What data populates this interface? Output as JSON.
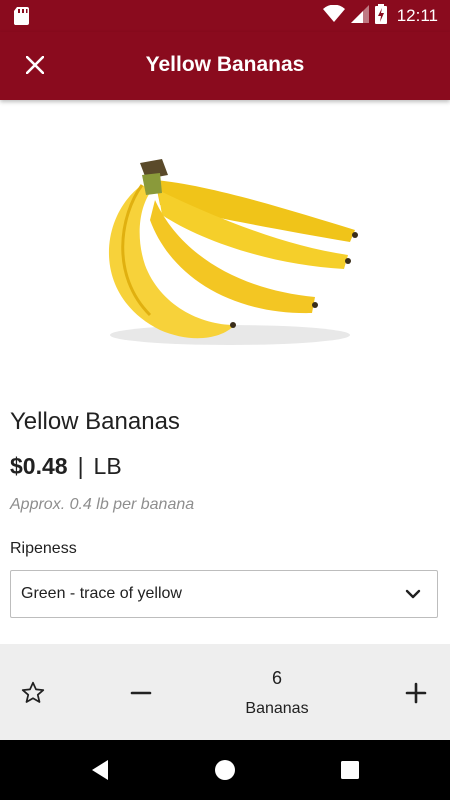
{
  "status_bar": {
    "time": "12:11",
    "icons": [
      "sd-card-icon",
      "wifi-icon",
      "cell-signal-icon",
      "battery-charging-icon"
    ]
  },
  "app_bar": {
    "title": "Yellow Bananas",
    "close_icon": "close-icon"
  },
  "product": {
    "image_icon": "bananas-image",
    "name": "Yellow Bananas",
    "price": "$0.48",
    "price_separator": "|",
    "unit": "LB",
    "approx_note": "Approx. 0.4 lb per banana"
  },
  "ripeness": {
    "label": "Ripeness",
    "selected": "Green - trace of yellow"
  },
  "cart_controls": {
    "favorite_icon": "star-outline-icon",
    "quantity": "6",
    "quantity_unit": "Bananas"
  },
  "nav_bar": {
    "icons": [
      "back-icon",
      "home-icon",
      "recents-icon"
    ]
  },
  "colors": {
    "brand": "#8a0b1e",
    "panel": "#eeeeee",
    "text": "#212121",
    "muted": "#8e8e8e"
  }
}
